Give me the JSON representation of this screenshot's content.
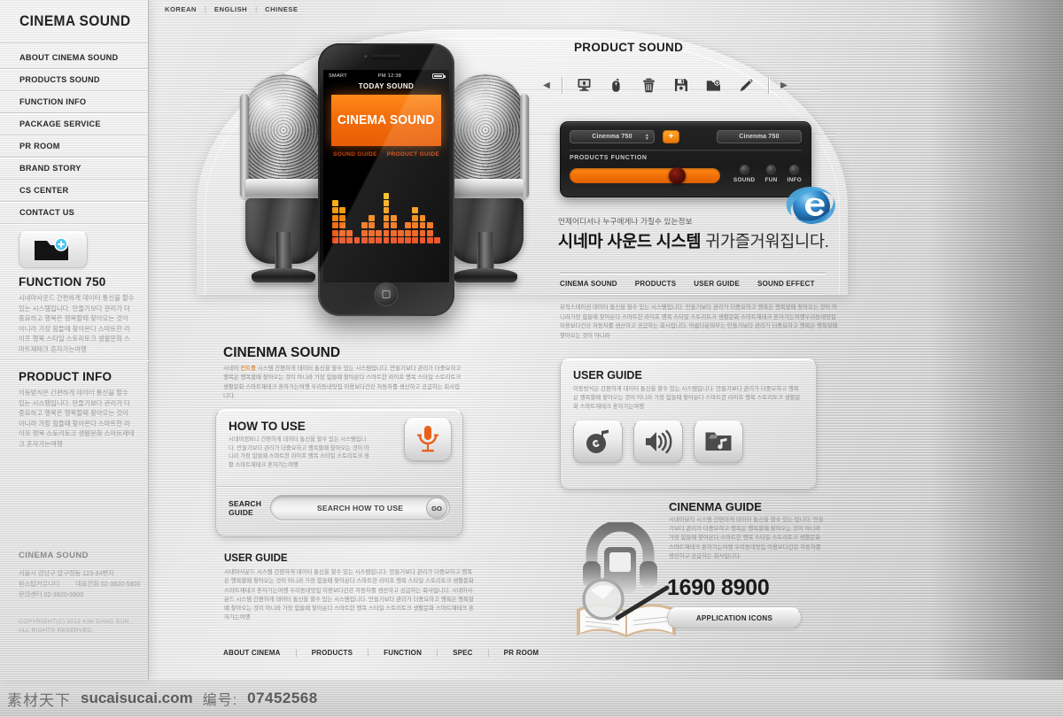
{
  "brand": {
    "title": "CINEMA SOUND"
  },
  "sidebar": {
    "items": [
      {
        "label": "ABOUT CINEMA SOUND"
      },
      {
        "label": "PRODUCTS SOUND"
      },
      {
        "label": "FUNCTION INFO"
      },
      {
        "label": "PACKAGE SERVICE"
      },
      {
        "label": "PR ROOM"
      },
      {
        "label": "BRAND STORY"
      },
      {
        "label": "CS CENTER"
      },
      {
        "label": "CONTACT US"
      }
    ],
    "function_block": {
      "heading": "FUNCTION 750",
      "body": "시네마사운드 간편하게 데이터 통신을 할수 있는 시스템입니다. 만들기보다 관리가 더중요하고 행복은 행복할때 찾아오는 것이 아니라 가장 힘들때 찾아온다 스마트한 라이프 행복 스타일 스토리토크 생활문화 스마트재테크 혼자가는여행"
    },
    "product_block": {
      "heading": "PRODUCT INFO",
      "body": "이동방식은 간편하게 데이터 통신을 할수 있는 시스템입니다. 만들기보다 관리가 더중요하고 행복은 행복할때 찾아오는 것이 아니라 가장 힘들때 찾아온다 스마트한 라이프 행복 스토리토크 생활문화 스마트재테크 혼자가는여행"
    },
    "footer": {
      "heading": "CINEMA SOUND",
      "line1": "서울시 강남구 압구정동 123-34번지",
      "line2_a": "원스탑커뮤니티",
      "line2_b": "대표전화  02-3920-5900",
      "line3": "문의센터 02-3920-5900",
      "copyright_1": "COPYRIGHT(C) 2012 KIM DANG SUN .",
      "copyright_2": "ALL RIGHTS RESERVED."
    }
  },
  "langbar": {
    "items": [
      "KOREAN",
      "ENGLISH",
      "CHINESE"
    ],
    "separator": "|"
  },
  "phone": {
    "status_carrier": "SMART",
    "status_time": "PM 12:38",
    "today_label": "TODAY SOUND",
    "banner_text": "CINEMA SOUND",
    "subnav": [
      "SOUND GUIDE",
      "PRODUCT GUIDE"
    ],
    "equalizer": {
      "levels": [
        6,
        5,
        2,
        1,
        3,
        4,
        2,
        7,
        4,
        2,
        3,
        5,
        4,
        3,
        1
      ],
      "max": 8
    }
  },
  "product_panel": {
    "title": "PRODUCT SOUND",
    "toolbar": {
      "prev": "◀",
      "next": "▶",
      "icons": [
        "monitor-lock-icon",
        "mouse-icon",
        "trash-icon",
        "floppy-save-icon",
        "folder-add-icon",
        "tag-pen-icon"
      ]
    },
    "control": {
      "dropdown_value": "Cinenma 750",
      "plus_label": "+",
      "display_value": "Cinenma 750",
      "function_label": "PRODUCTS FUNCTION",
      "knobs": [
        "SOUND",
        "FUN",
        "INFO"
      ],
      "accent_color": "#f07c0a"
    }
  },
  "lead": {
    "small": "언제어디서나 누구에게나 가질수 있는정보",
    "big_bold": "시네마 사운드 시스템",
    "big_rest": " 귀가즐거워집니다."
  },
  "right_tabs": [
    "CINEMA SOUND",
    "PRODUCTS",
    "USER GUIDE",
    "SOUND EFFECT"
  ],
  "right_paragraph": "뮤직스테이션 데이터 통신을 할수 있는 시스템입니다.  만들기보다 관리가 더중요하고 행복은 행복할때 찾아오는 것이 아니라가장 힘들때 찾아온다 스마트한 라이프 행복 스타일 스토리토크 생활문화 스마트재테크 혼자가는여행우리동네맛집 미용보다건강 자동차를 생산하고 공급하는 회사입니다. 아름다운피부는 만들기보다 관리가 더중요하고 행복은 행복할때 찾아오는 것이 아니라",
  "user_guide_panel": {
    "heading": "USER GUIDE",
    "body": "이동방식은 간편하게 데이터 통신을  할수 있는 시스템입니다. 만들기보다 관리가 더중요하고 행복은 행복할때 찾아오는 것이 아니라 가장 힘들때 찾아온다 스마트한 라이프 행복 스토리토크 생활문화 스마트재테크 혼자가는여행",
    "icons": [
      "music-disc-icon",
      "speaker-volume-icon",
      "music-folder-icon"
    ]
  },
  "cinema_guide": {
    "heading": "CINENMA GUIDE",
    "body": "시네마뮤직 시스템 간편하게 데이터 통신을 할수 있는 입니다.  만들기보다 관리가 더중요하고 행복은 행복할때 찾아오는 것이 아니라 가장 힘들때 찾아온다 스마트한 행복 스타일 스토리토크 생활문화 스마트재테크 혼자가는여행 우리동네맛집 미용보다건강 자동차를 생산하고 공급하는 회사입니다.",
    "phone_number": "1690 8900",
    "button_label": "APPLICATION ICONS"
  },
  "middle": {
    "heading": "CINENMA SOUND",
    "paragraph_pre": "시네마 ",
    "paragraph_orange": "컨트롤",
    "paragraph_post": " 시스템 간편하게 데이터 통신을 할수 있는 시스템입니다.  만들기보다 관리가 더중요하고 행복은 행복할때 찾아오는 것이 아니라 가장 힘들때 찾아온다  스마트한 라이프 행복 스타일 스토리토크 생활문화 스마트재테크 혼자가는여행 우리동네맛집 미용보다건강 자동차를 생산하고 공급하는 회사입니다.",
    "how_to_use": {
      "heading": "HOW TO USE",
      "body": "시네마컴퍼니 간편하게 데이터 통신을  할수 있는 시스템입니다.  만들기보다 관리가 더중요하고 행복할때 찾아오는 것이 아니라 가장 힘들때 스마트한 라이프 행복 스타일  스토리토크 생활 스마트재테크 혼자가는여행",
      "mic_icon": "microphone-icon",
      "search_label_line1": "SEARCH",
      "search_label_line2": "GUIDE",
      "search_placeholder": "SEARCH HOW TO USE",
      "go_label": "GO"
    },
    "user_guide": {
      "heading": "USER GUIDE",
      "body": "시네마사운드 시스템 간편하게 데이터 통신을 할수 있는 시스템입니다.  만들기보다 관리가 더중요하고 행복은 행복할때 찾아오는 것이 아니라 가장 힘들때 찾아온다  스마트한 라이프 행복 스타일 스토리토크 생활문화 스마트재테크 혼자가는여행 우리동네맛집 미용보다건강 자동차를 생산하고 공급하는 회사입니다. 시네마사운드 시스템 간편하게 데이터 통신을 할수 있는 시스템입니다.  만들기보다 관리가 더중요하고 행복은 행복할때 찾아오는 것이 아니라 가장 힘들때 찾아온다  스마트한 행복 스타일 스토리토크 생활문화 스마트재테크 혼자가는여행"
    }
  },
  "bottom_nav": [
    "ABOUT CINEMA",
    "PRODUCTS",
    "FUNCTION",
    "SPEC",
    "PR ROOM"
  ],
  "watermark": {
    "cn_brand": "素材天下",
    "site": "sucaisucai.com",
    "cn_label": "编号:",
    "number": "07452568"
  },
  "colors": {
    "orange": "#f0710a",
    "orange_light": "#ff9c1f",
    "dark_panel": "#1e1e1e",
    "text_dark": "#1d1d1d",
    "text_muted": "#8f8f8f"
  }
}
